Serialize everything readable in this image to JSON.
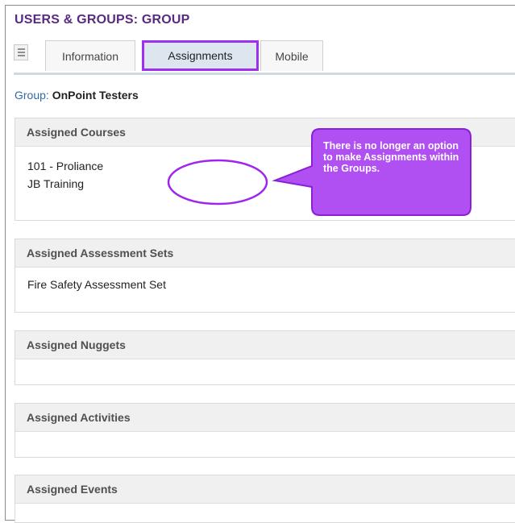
{
  "page": {
    "title": "USERS & GROUPS: GROUP"
  },
  "tabs": [
    {
      "label": "Information"
    },
    {
      "label": "Assignments"
    },
    {
      "label": "Mobile"
    }
  ],
  "group": {
    "prefix": "Group:",
    "name": "OnPoint Testers"
  },
  "panels": {
    "courses": {
      "title": "Assigned Courses",
      "items": [
        "101 - Proliance",
        "JB Training"
      ]
    },
    "assessments": {
      "title": "Assigned Assessment Sets",
      "items": [
        "Fire Safety Assessment Set"
      ]
    },
    "nuggets": {
      "title": "Assigned Nuggets"
    },
    "activities": {
      "title": "Assigned Activities"
    },
    "events": {
      "title": "Assigned Events"
    }
  },
  "callout": {
    "text": "There is no longer an option to make Assignments within the Groups.",
    "color": "#a024f0"
  },
  "colors": {
    "title": "#5a2a82",
    "highlight": "#9b30f0"
  }
}
